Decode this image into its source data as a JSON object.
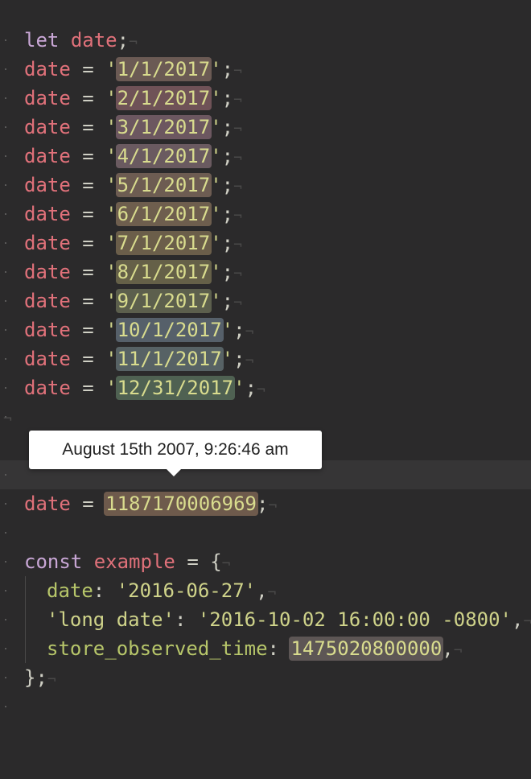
{
  "code": {
    "line1": {
      "kw": "let",
      "name": "date",
      "end": ";"
    },
    "dates": [
      {
        "name": "date",
        "eq": "=",
        "q1": "'",
        "value": "1/1/2017",
        "q2": "'",
        "end": ";",
        "color": "#6b5a54"
      },
      {
        "name": "date",
        "eq": "=",
        "q1": "'",
        "value": "2/1/2017",
        "q2": "'",
        "end": ";",
        "color": "#6f5257"
      },
      {
        "name": "date",
        "eq": "=",
        "q1": "'",
        "value": "3/1/2017",
        "q2": "'",
        "end": ";",
        "color": "#6c5760"
      },
      {
        "name": "date",
        "eq": "=",
        "q1": "'",
        "value": "4/1/2017",
        "q2": "'",
        "end": ";",
        "color": "#6a5a60"
      },
      {
        "name": "date",
        "eq": "=",
        "q1": "'",
        "value": "5/1/2017",
        "q2": "'",
        "end": ";",
        "color": "#6d5c52"
      },
      {
        "name": "date",
        "eq": "=",
        "q1": "'",
        "value": "6/1/2017",
        "q2": "'",
        "end": ";",
        "color": "#6e5e4e"
      },
      {
        "name": "date",
        "eq": "=",
        "q1": "'",
        "value": "7/1/2017",
        "q2": "'",
        "end": ";",
        "color": "#6b5e4a"
      },
      {
        "name": "date",
        "eq": "=",
        "q1": "'",
        "value": "8/1/2017",
        "q2": "'",
        "end": ";",
        "color": "#656048"
      },
      {
        "name": "date",
        "eq": "=",
        "q1": "'",
        "value": "9/1/2017",
        "q2": "'",
        "end": ";",
        "color": "#5c5f4d"
      },
      {
        "name": "date",
        "eq": "=",
        "q1": "'",
        "value": "10/1/2017",
        "q2": "'",
        "end": ";",
        "color": "#56606a"
      },
      {
        "name": "date",
        "eq": "=",
        "q1": "'",
        "value": "11/1/2017",
        "q2": "'",
        "end": ";",
        "color": "#576265"
      },
      {
        "name": "date",
        "eq": "=",
        "q1": "'",
        "value": "12/31/2017",
        "q2": "'",
        "end": ";",
        "color": "#4f6152"
      }
    ],
    "timestamp": {
      "name": "date",
      "eq": "=",
      "value": "1187170006969",
      "end": ";",
      "color": "#6e5a4c"
    },
    "const": {
      "kw": "const",
      "name": "example",
      "eq": "=",
      "open": "{"
    },
    "props": {
      "date_key": "date",
      "date_colon": ":",
      "date_value": "'2016-06-27'",
      "date_comma": ",",
      "long_key": "'long date'",
      "long_colon": ":",
      "long_value": "'2016-10-02 16:00:00 -0800'",
      "long_comma": ",",
      "store_key": "store_observed_time",
      "store_colon": ":",
      "store_value": "1475020800000",
      "store_comma": ",",
      "store_color": "#5d5655"
    },
    "close": "};"
  },
  "tooltip": {
    "text": "August 15th 2007, 9:26:46 am"
  }
}
